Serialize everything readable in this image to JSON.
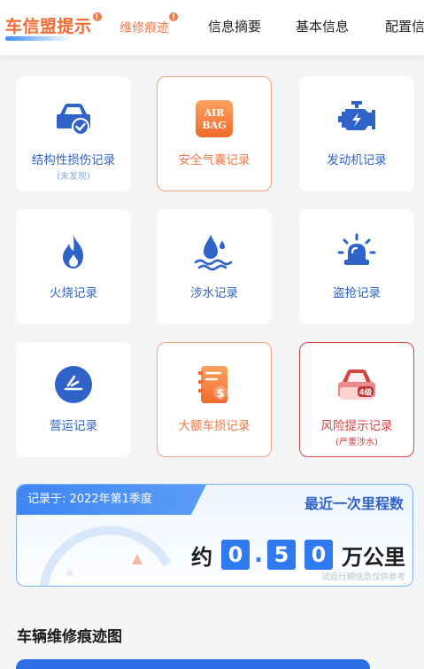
{
  "tabs": {
    "brand": "车信盟提示",
    "brand_badge": "!",
    "repair": "维修痕迹",
    "repair_badge": "!",
    "summary": "信息摘要",
    "basic": "基本信息",
    "config": "配置信"
  },
  "records": [
    {
      "label": "结构性损伤记录",
      "sub": "(未发现)",
      "icon": "car-damage-icon",
      "status": "normal"
    },
    {
      "label": "安全气囊记录",
      "icon": "airbag-icon",
      "icon_text": [
        "AIR",
        "BAG"
      ],
      "status": "warn"
    },
    {
      "label": "发动机记录",
      "icon": "engine-icon",
      "status": "normal"
    },
    {
      "label": "火烧记录",
      "icon": "fire-icon",
      "status": "normal"
    },
    {
      "label": "涉水记录",
      "icon": "water-icon",
      "status": "normal"
    },
    {
      "label": "盗抢记录",
      "icon": "alarm-light-icon",
      "status": "normal"
    },
    {
      "label": "营运记录",
      "icon": "operation-icon",
      "status": "normal"
    },
    {
      "label": "大额车损记录",
      "icon": "money-bill-icon",
      "status": "warn"
    },
    {
      "label": "风险提示记录",
      "sub": "(严重涉水)",
      "icon": "risk-car-icon",
      "icon_text": [
        "4级"
      ],
      "status": "danger"
    }
  ],
  "mileage": {
    "recorded_at": "记录于: 2022年第1季度",
    "title": "最近一次里程数",
    "prefix": "约",
    "digits": [
      "0",
      ".",
      "5",
      "0"
    ],
    "unit": "万公里",
    "note": "试运行期信息仅供参考"
  },
  "section": {
    "title": "车辆维修痕迹图"
  },
  "colors": {
    "accent_orange": "#f07a4a",
    "primary_blue": "#2f63c8",
    "danger_red": "#d64545",
    "digit_blue": "#2f7af0"
  }
}
